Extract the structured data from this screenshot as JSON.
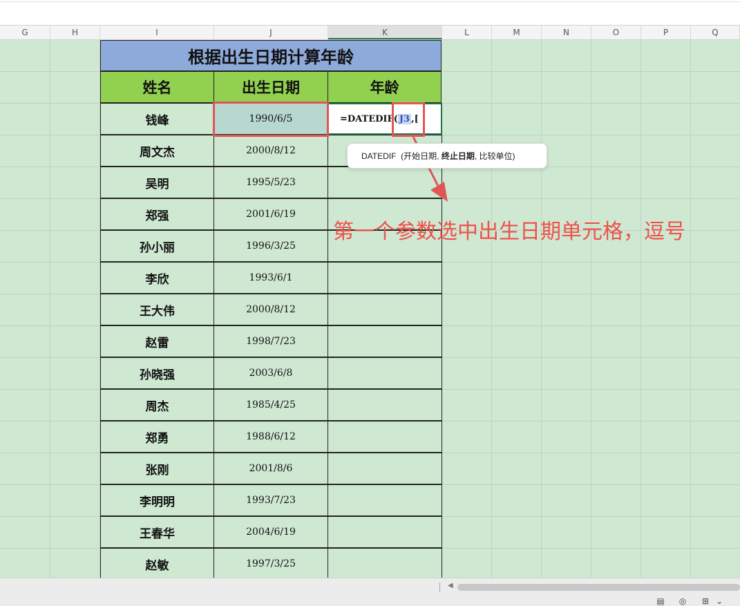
{
  "columns": [
    "G",
    "H",
    "I",
    "J",
    "K",
    "L",
    "M",
    "N",
    "O",
    "P",
    "Q"
  ],
  "active_column": "K",
  "title": "根据出生日期计算年龄",
  "headers": {
    "name": "姓名",
    "birthdate": "出生日期",
    "age": "年龄"
  },
  "rows": [
    {
      "name": "钱峰",
      "birthdate": "1990/6/5"
    },
    {
      "name": "周文杰",
      "birthdate": "2000/8/12"
    },
    {
      "name": "吴明",
      "birthdate": "1995/5/23"
    },
    {
      "name": "郑强",
      "birthdate": "2001/6/19"
    },
    {
      "name": "孙小丽",
      "birthdate": "1996/3/25"
    },
    {
      "name": "李欣",
      "birthdate": "1993/6/1"
    },
    {
      "name": "王大伟",
      "birthdate": "2000/8/12"
    },
    {
      "name": "赵雷",
      "birthdate": "1998/7/23"
    },
    {
      "name": "孙晓强",
      "birthdate": "2003/6/8"
    },
    {
      "name": "周杰",
      "birthdate": "1985/4/25"
    },
    {
      "name": "郑勇",
      "birthdate": "1988/6/12"
    },
    {
      "name": "张刚",
      "birthdate": "2001/8/6"
    },
    {
      "name": "李明明",
      "birthdate": "1993/7/23"
    },
    {
      "name": "王春华",
      "birthdate": "2004/6/19"
    },
    {
      "name": "赵敏",
      "birthdate": "1997/3/25"
    }
  ],
  "formula": {
    "prefix": "=DATEDIF(",
    "ref": "J3",
    "suffix": ",["
  },
  "tooltip": {
    "func": "DATEDIF",
    "open": "(开始日期,",
    "current": "终止日期",
    "rest": ", 比较单位)"
  },
  "annotation": "第一个参数选中出生日期单元格，逗号",
  "colors": {
    "title_bg": "#8eaadb",
    "header_bg": "#92d050",
    "sheet_bg": "#cfe8d2",
    "highlight": "#e25555",
    "annotation": "#f0504a"
  }
}
